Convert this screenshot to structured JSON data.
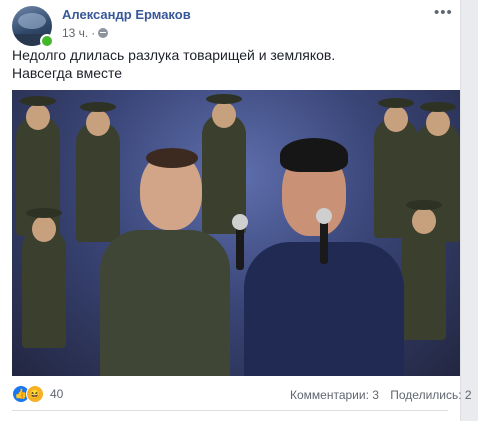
{
  "post": {
    "author": "Александр Ермаков",
    "time": "13 ч.",
    "time_separator": "·",
    "more_label": "•••",
    "text_line1": "Недолго длилась разлука товарищей и земляков.",
    "text_line2": "Навсегда вместе",
    "icons": {
      "privacy": "globe-icon",
      "more": "more-icon",
      "like": "like-reaction-icon",
      "haha": "haha-reaction-icon"
    }
  },
  "reactions": {
    "count": "40",
    "like_glyph": "👍",
    "haha_glyph": "😆"
  },
  "stats": {
    "comments": "Комментарии: 3",
    "shares": "Поделились: 2"
  },
  "colors": {
    "author_link": "#385898",
    "online": "#42b72a",
    "like": "#1877f2",
    "haha": "#f7b125",
    "meta_text": "#616770"
  }
}
